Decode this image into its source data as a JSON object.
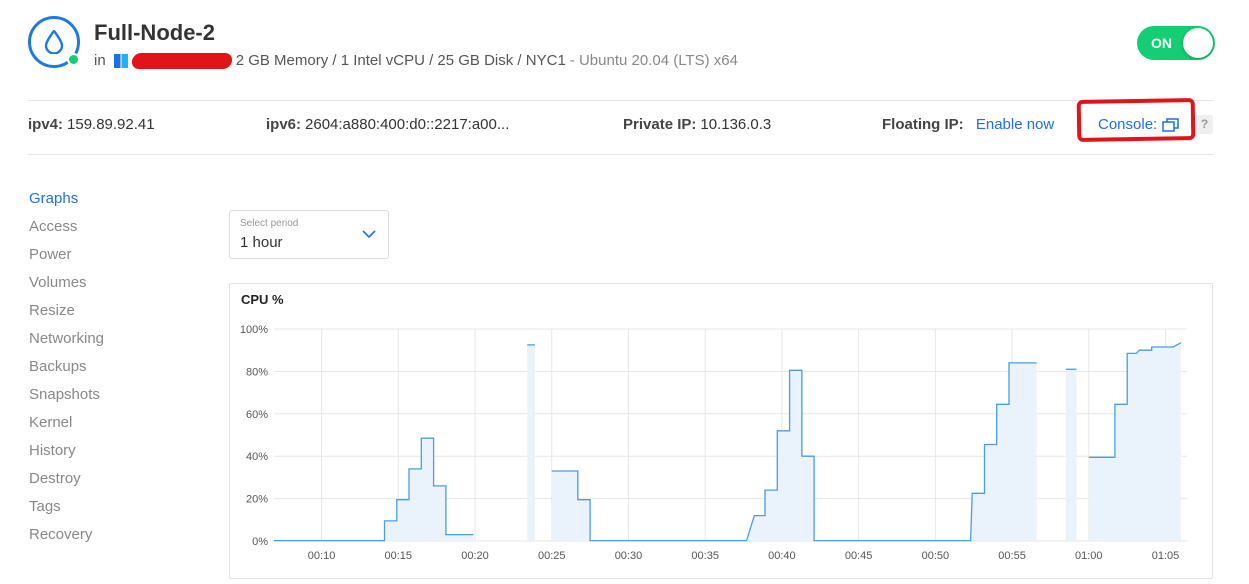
{
  "header": {
    "title": "Full-Node-2",
    "in_label": "in",
    "specs": "2 GB Memory / 1 Intel vCPU / 25 GB Disk / NYC1",
    "os": "- Ubuntu 20.04 (LTS) x64",
    "power_toggle_label": "ON",
    "status_color": "#15cd72"
  },
  "info": {
    "ipv4_label": "ipv4:",
    "ipv4_value": "159.89.92.41",
    "ipv6_label": "ipv6:",
    "ipv6_value": "2604:a880:400:d0::2217:a00...",
    "private_ip_label": "Private IP:",
    "private_ip_value": "10.136.0.3",
    "floating_ip_label": "Floating IP:",
    "floating_ip_link": "Enable now",
    "console_label": "Console:",
    "help_label": "?"
  },
  "nav": {
    "items": [
      "Graphs",
      "Access",
      "Power",
      "Volumes",
      "Resize",
      "Networking",
      "Backups",
      "Snapshots",
      "Kernel",
      "History",
      "Destroy",
      "Tags",
      "Recovery"
    ],
    "active": "Graphs"
  },
  "period": {
    "caption": "Select period",
    "value": "1 hour"
  },
  "colors": {
    "accent": "#1f6fe0",
    "on_green": "#15cd72",
    "annotation_red": "#e0141a",
    "chart_line": "#4a9de0",
    "chart_fill": "#eaf3fc"
  },
  "chart_data": {
    "type": "area",
    "title": "CPU %",
    "xlabel": "",
    "ylabel": "",
    "ylim": [
      0,
      100
    ],
    "y_ticks": [
      "0%",
      "20%",
      "40%",
      "60%",
      "80%",
      "100%"
    ],
    "x_ticks": [
      "00:10",
      "00:15",
      "00:20",
      "00:25",
      "00:30",
      "00:35",
      "00:40",
      "00:45",
      "00:50",
      "00:55",
      "01:00",
      "01:05"
    ],
    "x_tick_minutes": [
      10,
      15,
      20,
      25,
      30,
      35,
      40,
      45,
      50,
      55,
      60,
      65
    ],
    "x_range_minutes": [
      6.9,
      66.4
    ],
    "grid": true,
    "series": [
      {
        "segments": [
          [
            [
              6.9,
              0.2
            ],
            [
              14.1,
              0.2
            ],
            [
              14.1,
              9.5
            ],
            [
              14.9,
              9.5
            ],
            [
              14.9,
              19.5
            ],
            [
              15.7,
              19.5
            ],
            [
              15.7,
              34
            ],
            [
              16.5,
              34
            ],
            [
              16.5,
              48.5
            ],
            [
              17.3,
              48.5
            ],
            [
              17.3,
              26
            ],
            [
              18.1,
              26
            ],
            [
              18.1,
              3
            ],
            [
              19.9,
              3
            ]
          ],
          [
            [
              23.4,
              92.5
            ],
            [
              23.9,
              92.5
            ]
          ],
          [
            [
              25.0,
              33
            ],
            [
              26.7,
              33
            ],
            [
              26.7,
              19.5
            ],
            [
              27.5,
              19.5
            ],
            [
              27.5,
              0.2
            ],
            [
              31,
              0.2
            ],
            [
              37.7,
              0.2
            ],
            [
              38.2,
              12
            ],
            [
              38.9,
              12
            ],
            [
              38.9,
              24
            ],
            [
              39.7,
              24
            ],
            [
              39.7,
              52
            ],
            [
              40.5,
              52
            ],
            [
              40.5,
              80.5
            ],
            [
              41.3,
              80.5
            ],
            [
              41.3,
              40
            ],
            [
              42.1,
              40
            ],
            [
              42.1,
              0.2
            ],
            [
              48,
              0.2
            ],
            [
              52.3,
              0.2
            ],
            [
              52.4,
              22.5
            ],
            [
              53.2,
              22.5
            ],
            [
              53.2,
              45.5
            ],
            [
              54.0,
              45.5
            ],
            [
              54.0,
              64.5
            ],
            [
              54.8,
              64.5
            ],
            [
              54.8,
              84
            ],
            [
              56.6,
              84
            ]
          ],
          [
            [
              58.5,
              81
            ],
            [
              59.2,
              81
            ]
          ],
          [
            [
              60.0,
              39.5
            ],
            [
              61.7,
              39.5
            ],
            [
              61.7,
              64.5
            ],
            [
              62.5,
              64.5
            ],
            [
              62.5,
              88.5
            ],
            [
              63.1,
              88.5
            ],
            [
              63.3,
              90
            ],
            [
              64.1,
              90
            ],
            [
              64.1,
              91.5
            ],
            [
              65.5,
              91.5
            ],
            [
              66.0,
              93.5
            ]
          ]
        ]
      }
    ]
  }
}
